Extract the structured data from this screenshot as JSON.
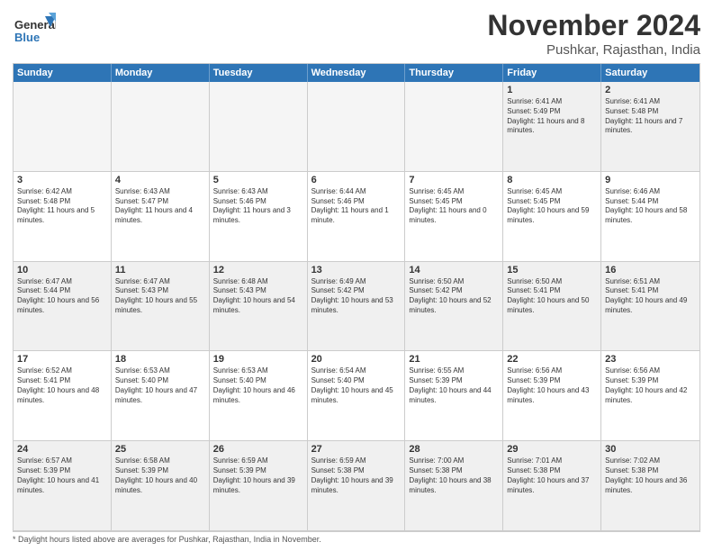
{
  "logo": {
    "general": "General",
    "blue": "Blue"
  },
  "title": "November 2024",
  "location": "Pushkar, Rajasthan, India",
  "header": {
    "days": [
      "Sunday",
      "Monday",
      "Tuesday",
      "Wednesday",
      "Thursday",
      "Friday",
      "Saturday"
    ]
  },
  "footer": {
    "note": "Daylight hours"
  },
  "weeks": [
    [
      {
        "day": "",
        "empty": true
      },
      {
        "day": "",
        "empty": true
      },
      {
        "day": "",
        "empty": true
      },
      {
        "day": "",
        "empty": true
      },
      {
        "day": "",
        "empty": true
      },
      {
        "day": "1",
        "sunrise": "Sunrise: 6:41 AM",
        "sunset": "Sunset: 5:49 PM",
        "daylight": "Daylight: 11 hours and 8 minutes."
      },
      {
        "day": "2",
        "sunrise": "Sunrise: 6:41 AM",
        "sunset": "Sunset: 5:48 PM",
        "daylight": "Daylight: 11 hours and 7 minutes."
      }
    ],
    [
      {
        "day": "3",
        "sunrise": "Sunrise: 6:42 AM",
        "sunset": "Sunset: 5:48 PM",
        "daylight": "Daylight: 11 hours and 5 minutes."
      },
      {
        "day": "4",
        "sunrise": "Sunrise: 6:43 AM",
        "sunset": "Sunset: 5:47 PM",
        "daylight": "Daylight: 11 hours and 4 minutes."
      },
      {
        "day": "5",
        "sunrise": "Sunrise: 6:43 AM",
        "sunset": "Sunset: 5:46 PM",
        "daylight": "Daylight: 11 hours and 3 minutes."
      },
      {
        "day": "6",
        "sunrise": "Sunrise: 6:44 AM",
        "sunset": "Sunset: 5:46 PM",
        "daylight": "Daylight: 11 hours and 1 minute."
      },
      {
        "day": "7",
        "sunrise": "Sunrise: 6:45 AM",
        "sunset": "Sunset: 5:45 PM",
        "daylight": "Daylight: 11 hours and 0 minutes."
      },
      {
        "day": "8",
        "sunrise": "Sunrise: 6:45 AM",
        "sunset": "Sunset: 5:45 PM",
        "daylight": "Daylight: 10 hours and 59 minutes."
      },
      {
        "day": "9",
        "sunrise": "Sunrise: 6:46 AM",
        "sunset": "Sunset: 5:44 PM",
        "daylight": "Daylight: 10 hours and 58 minutes."
      }
    ],
    [
      {
        "day": "10",
        "sunrise": "Sunrise: 6:47 AM",
        "sunset": "Sunset: 5:44 PM",
        "daylight": "Daylight: 10 hours and 56 minutes."
      },
      {
        "day": "11",
        "sunrise": "Sunrise: 6:47 AM",
        "sunset": "Sunset: 5:43 PM",
        "daylight": "Daylight: 10 hours and 55 minutes."
      },
      {
        "day": "12",
        "sunrise": "Sunrise: 6:48 AM",
        "sunset": "Sunset: 5:43 PM",
        "daylight": "Daylight: 10 hours and 54 minutes."
      },
      {
        "day": "13",
        "sunrise": "Sunrise: 6:49 AM",
        "sunset": "Sunset: 5:42 PM",
        "daylight": "Daylight: 10 hours and 53 minutes."
      },
      {
        "day": "14",
        "sunrise": "Sunrise: 6:50 AM",
        "sunset": "Sunset: 5:42 PM",
        "daylight": "Daylight: 10 hours and 52 minutes."
      },
      {
        "day": "15",
        "sunrise": "Sunrise: 6:50 AM",
        "sunset": "Sunset: 5:41 PM",
        "daylight": "Daylight: 10 hours and 50 minutes."
      },
      {
        "day": "16",
        "sunrise": "Sunrise: 6:51 AM",
        "sunset": "Sunset: 5:41 PM",
        "daylight": "Daylight: 10 hours and 49 minutes."
      }
    ],
    [
      {
        "day": "17",
        "sunrise": "Sunrise: 6:52 AM",
        "sunset": "Sunset: 5:41 PM",
        "daylight": "Daylight: 10 hours and 48 minutes."
      },
      {
        "day": "18",
        "sunrise": "Sunrise: 6:53 AM",
        "sunset": "Sunset: 5:40 PM",
        "daylight": "Daylight: 10 hours and 47 minutes."
      },
      {
        "day": "19",
        "sunrise": "Sunrise: 6:53 AM",
        "sunset": "Sunset: 5:40 PM",
        "daylight": "Daylight: 10 hours and 46 minutes."
      },
      {
        "day": "20",
        "sunrise": "Sunrise: 6:54 AM",
        "sunset": "Sunset: 5:40 PM",
        "daylight": "Daylight: 10 hours and 45 minutes."
      },
      {
        "day": "21",
        "sunrise": "Sunrise: 6:55 AM",
        "sunset": "Sunset: 5:39 PM",
        "daylight": "Daylight: 10 hours and 44 minutes."
      },
      {
        "day": "22",
        "sunrise": "Sunrise: 6:56 AM",
        "sunset": "Sunset: 5:39 PM",
        "daylight": "Daylight: 10 hours and 43 minutes."
      },
      {
        "day": "23",
        "sunrise": "Sunrise: 6:56 AM",
        "sunset": "Sunset: 5:39 PM",
        "daylight": "Daylight: 10 hours and 42 minutes."
      }
    ],
    [
      {
        "day": "24",
        "sunrise": "Sunrise: 6:57 AM",
        "sunset": "Sunset: 5:39 PM",
        "daylight": "Daylight: 10 hours and 41 minutes."
      },
      {
        "day": "25",
        "sunrise": "Sunrise: 6:58 AM",
        "sunset": "Sunset: 5:39 PM",
        "daylight": "Daylight: 10 hours and 40 minutes."
      },
      {
        "day": "26",
        "sunrise": "Sunrise: 6:59 AM",
        "sunset": "Sunset: 5:39 PM",
        "daylight": "Daylight: 10 hours and 39 minutes."
      },
      {
        "day": "27",
        "sunrise": "Sunrise: 6:59 AM",
        "sunset": "Sunset: 5:38 PM",
        "daylight": "Daylight: 10 hours and 39 minutes."
      },
      {
        "day": "28",
        "sunrise": "Sunrise: 7:00 AM",
        "sunset": "Sunset: 5:38 PM",
        "daylight": "Daylight: 10 hours and 38 minutes."
      },
      {
        "day": "29",
        "sunrise": "Sunrise: 7:01 AM",
        "sunset": "Sunset: 5:38 PM",
        "daylight": "Daylight: 10 hours and 37 minutes."
      },
      {
        "day": "30",
        "sunrise": "Sunrise: 7:02 AM",
        "sunset": "Sunset: 5:38 PM",
        "daylight": "Daylight: 10 hours and 36 minutes."
      }
    ]
  ]
}
